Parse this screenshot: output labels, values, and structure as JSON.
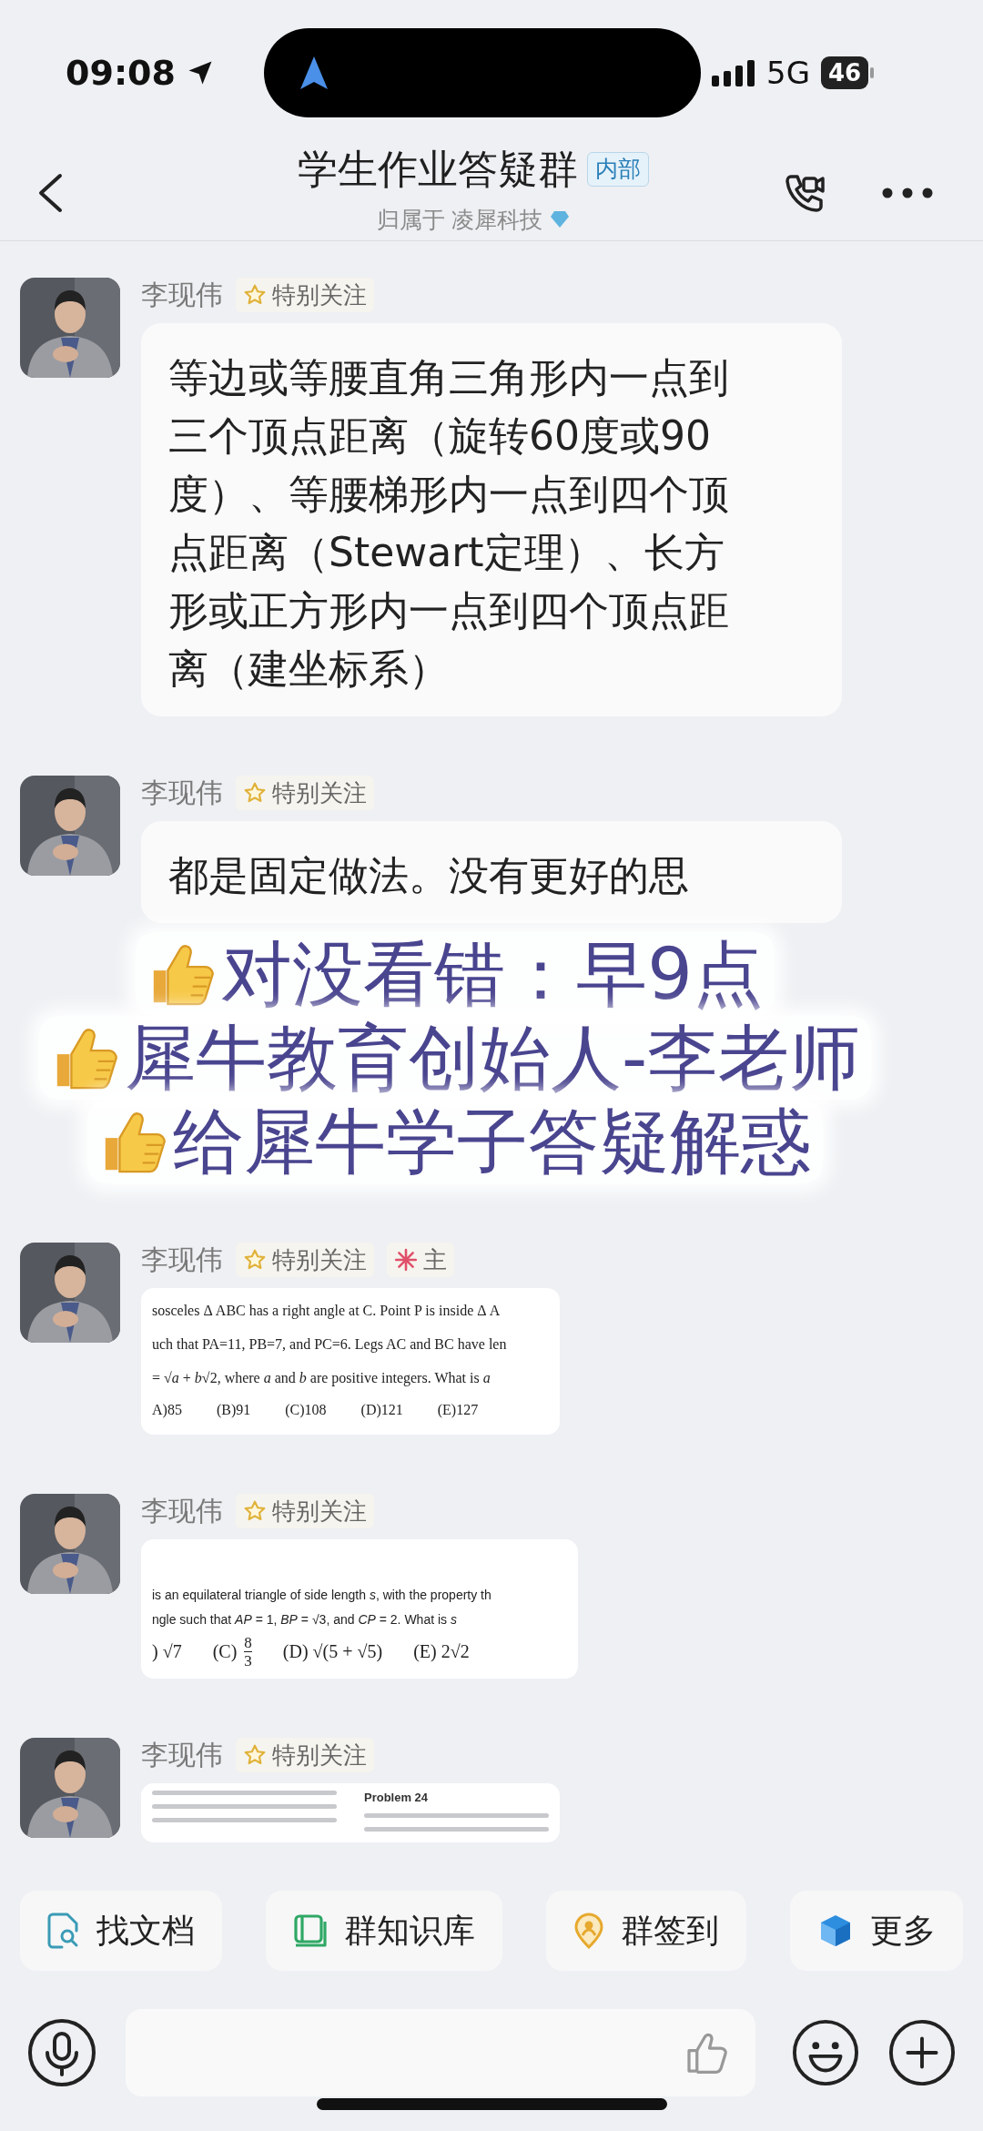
{
  "status_bar": {
    "time": "09:08",
    "network": "5G",
    "battery": "46"
  },
  "header": {
    "title": "学生作业答疑群",
    "badge": "内部",
    "subtitle": "归属于 凌犀科技"
  },
  "chat": [
    {
      "kind": "text",
      "sender": "李现伟",
      "tags": [
        {
          "kind": "star",
          "label": "特别关注"
        }
      ],
      "text": "等边或等腰直角三角形内一点到三个顶点距离（旋转60度或90度）、等腰梯形内一点到四个顶点距离（Stewart定理）、长方形或正方形内一点到四个顶点距离（建坐标系）"
    },
    {
      "kind": "text",
      "sender": "李现伟",
      "tags": [
        {
          "kind": "star",
          "label": "特别关注"
        }
      ],
      "text": "都是固定做法。没有更好的思"
    },
    {
      "kind": "caption",
      "lines": [
        "对没看错：早9点",
        "犀牛教育创始人-李老师",
        "给犀牛学子答疑解惑"
      ]
    },
    {
      "kind": "document",
      "sender": "李现伟",
      "tags": [
        {
          "kind": "star",
          "label": "特别关注"
        },
        {
          "kind": "flower",
          "label": "主"
        }
      ],
      "lines": [
        "sosceles Δ ABC has a right angle at C. Point P is inside Δ A",
        "uch that PA=11, PB=7, and PC=6. Legs AC and BC have len",
        "= √*a* + *b*√2, where *a* and *b* are positive integers. What is *a*"
      ],
      "options": [
        {
          "kind": "text",
          "text": "A)85"
        },
        {
          "kind": "text",
          "text": "(B)91"
        },
        {
          "kind": "text",
          "text": "(C)108"
        },
        {
          "kind": "text",
          "text": "(D)121"
        },
        {
          "kind": "text",
          "text": "(E)127"
        }
      ]
    },
    {
      "kind": "document",
      "sender": "李现伟",
      "tags": [
        {
          "kind": "star",
          "label": "特别关注"
        }
      ],
      "lines": [
        "is an equilateral triangle of side length *s*, with the property th",
        "ngle such that *AP* = 1, *BP* = √3, and *CP* = 2. What is *s*"
      ],
      "options": [
        {
          "kind": "text",
          "text": ") √7"
        },
        {
          "kind": "fraction",
          "label": "(C)",
          "numerator": "8",
          "denominator": "3"
        },
        {
          "kind": "text",
          "text": "(D) √(5 + √5)"
        },
        {
          "kind": "text",
          "text": "(E) 2√2"
        }
      ]
    },
    {
      "kind": "preview",
      "sender": "李现伟",
      "tags": [
        {
          "kind": "star",
          "label": "特别关注"
        }
      ],
      "heading": "Problem 24"
    }
  ],
  "quick_actions": [
    {
      "kind": "documents",
      "label": "找文档"
    },
    {
      "kind": "knowledge",
      "label": "群知识库"
    },
    {
      "kind": "checkin",
      "label": "群签到"
    },
    {
      "kind": "more",
      "label": "更多"
    }
  ]
}
